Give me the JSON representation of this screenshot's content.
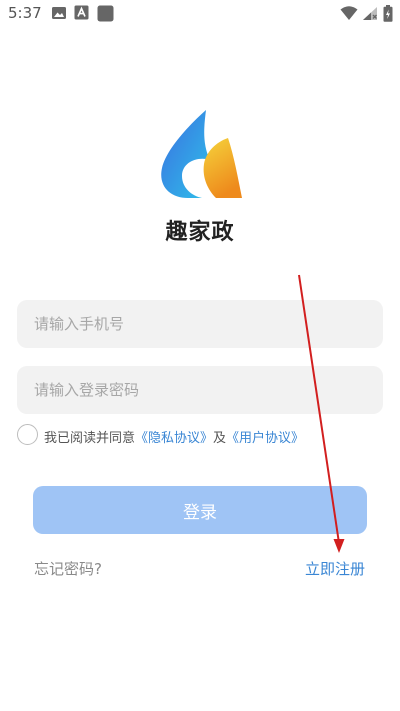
{
  "status_bar": {
    "time": "5:37",
    "left_icons": [
      "photo-icon",
      "a-letter-icon",
      "square-icon"
    ],
    "right_icons": [
      "wifi-icon",
      "signal-icon",
      "battery-icon"
    ]
  },
  "app": {
    "name": "趣家政",
    "logo_colors": [
      "#3a7bd5",
      "#2fb6e8",
      "#f2c232",
      "#f08a1c"
    ]
  },
  "login_form": {
    "phone_placeholder": "请输入手机号",
    "password_placeholder": "请输入登录密码",
    "agreement": {
      "prefix": "我已阅读并同意",
      "privacy_link": "《隐私协议》",
      "connector": "及",
      "user_link": "《用户协议》",
      "checked": false
    },
    "login_label": "登录",
    "forgot_label": "忘记密码?",
    "register_label": "立即注册"
  },
  "colors": {
    "accent": "#3a86d4",
    "login_button_bg": "#9fc4f5",
    "input_bg": "#f2f2f2",
    "annotation_arrow": "#d21f1f"
  }
}
